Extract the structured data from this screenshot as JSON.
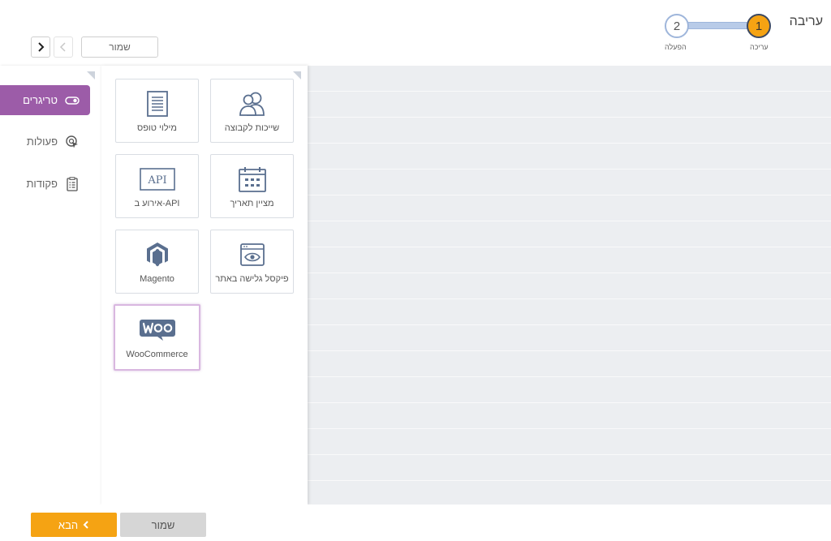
{
  "header": {
    "title": "עריבה",
    "steps": [
      {
        "number": "1",
        "label": "עריכה",
        "state": "active"
      },
      {
        "number": "2",
        "label": "הפעלה",
        "state": "pending"
      }
    ],
    "save_label": "שמור"
  },
  "sidebar": {
    "items": [
      {
        "label": "טריגרים",
        "icon": "toggle-icon",
        "active": true
      },
      {
        "label": "פעולות",
        "icon": "cursor-click-icon",
        "active": false
      },
      {
        "label": "פקודות",
        "icon": "clipboard-list-icon",
        "active": false
      }
    ]
  },
  "triggers": [
    {
      "label": "שייכות לקבוצה",
      "icon": "users-icon"
    },
    {
      "label": "מילוי טופס",
      "icon": "document-form-icon"
    },
    {
      "label": "מציין תאריך",
      "icon": "calendar-icon"
    },
    {
      "label": "אירוע ב-API",
      "icon": "api-icon"
    },
    {
      "label": "פיקסל גלישה באתר",
      "icon": "browser-eye-icon"
    },
    {
      "label": "Magento",
      "icon": "magento-icon"
    },
    {
      "label": "WooCommerce",
      "icon": "woocommerce-icon",
      "selected": true
    }
  ],
  "footer": {
    "next_label": "הבא",
    "save_label": "שמור"
  },
  "colors": {
    "accent_orange": "#f5a313",
    "accent_purple": "#9c5ca8",
    "icon_blue": "#5a6f8f",
    "canvas_bg": "#eceef1"
  }
}
